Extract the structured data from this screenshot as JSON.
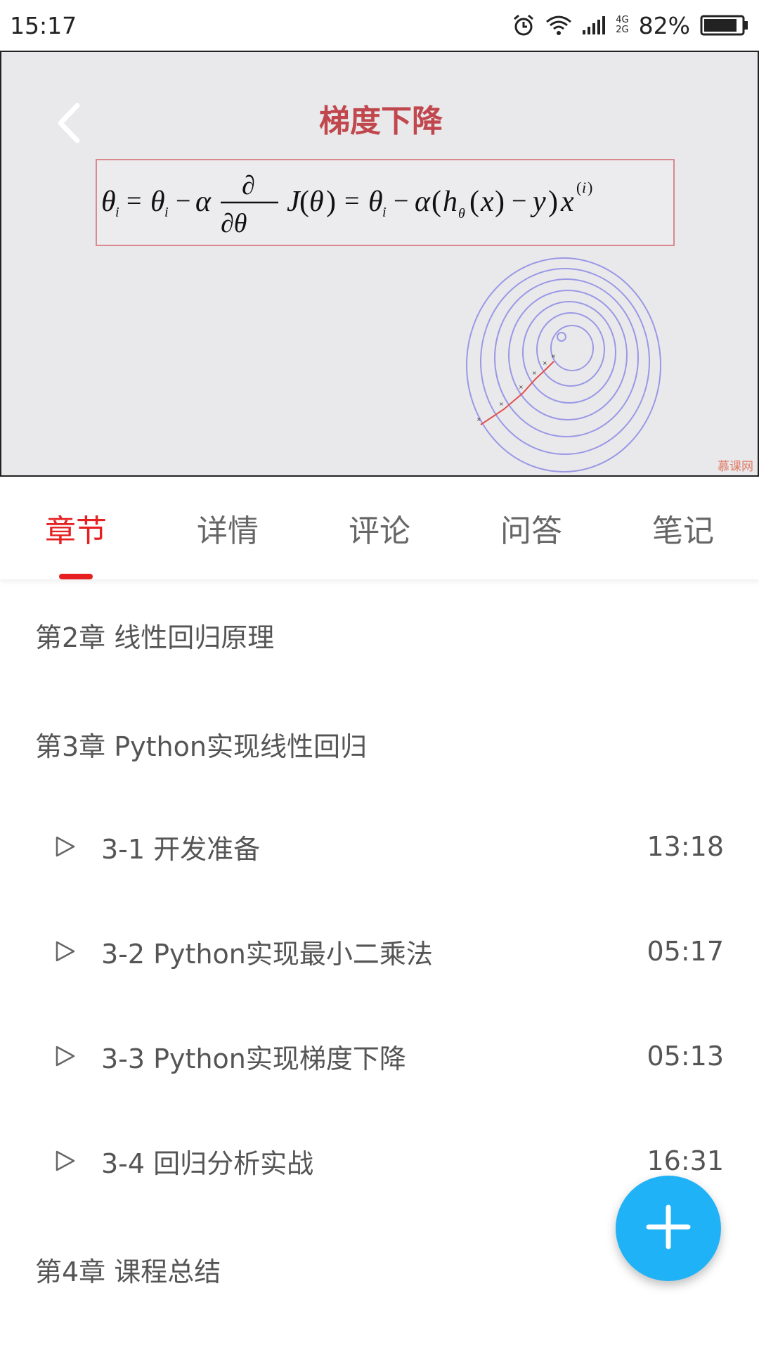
{
  "status_bar": {
    "time": "15:17",
    "net_top": "4G",
    "net_bottom": "2G",
    "battery": "82%",
    "icons": [
      "alarm-icon",
      "wifi-icon",
      "signal-icon",
      "battery-icon"
    ]
  },
  "player": {
    "slide_title": "梯度下降",
    "watermark": "慕课网",
    "accent_color": "#c0474d"
  },
  "tabs": [
    {
      "label": "章节",
      "active": true
    },
    {
      "label": "详情",
      "active": false
    },
    {
      "label": "评论",
      "active": false
    },
    {
      "label": "问答",
      "active": false
    },
    {
      "label": "笔记",
      "active": false
    }
  ],
  "chapters": [
    {
      "title": "第2章  线性回归原理"
    },
    {
      "title": "第3章 Python实现线性回归"
    },
    {
      "title": "第4章  课程总结"
    }
  ],
  "lessons": [
    {
      "title": "3-1 开发准备",
      "duration": "13:18"
    },
    {
      "title": "3-2 Python实现最小二乘法",
      "duration": "05:17"
    },
    {
      "title": "3-3 Python实现梯度下降",
      "duration": "05:13"
    },
    {
      "title": "3-4 回归分析实战",
      "duration": "16:31"
    }
  ],
  "colors": {
    "active_tab": "#e62020",
    "fab": "#20b2f7"
  }
}
